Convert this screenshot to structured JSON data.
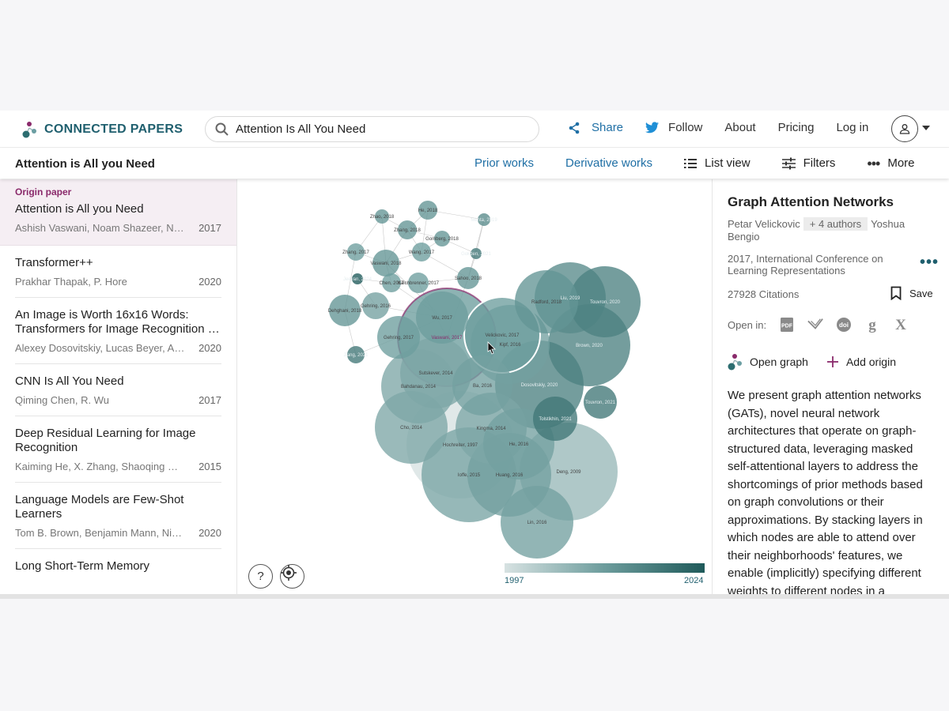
{
  "app": {
    "logo_text": "CONNECTED PAPERS",
    "search_value": "Attention Is All You Need"
  },
  "nav": {
    "share": "Share",
    "follow": "Follow",
    "about": "About",
    "pricing": "Pricing",
    "login": "Log in"
  },
  "subbar": {
    "title": "Attention is All you Need",
    "prior": "Prior works",
    "derivative": "Derivative works",
    "list_view": "List view",
    "filters": "Filters",
    "more": "More"
  },
  "sidebar": {
    "origin_label": "Origin paper",
    "origin": {
      "title": "Attention is All you Need",
      "authors": "Ashish Vaswani, Noam Shazeer, Niki Parmar",
      "year": "2017"
    },
    "items": [
      {
        "title": "Transformer++",
        "authors": "Prakhar Thapak, P. Hore",
        "year": "2020"
      },
      {
        "title": "An Image is Worth 16x16 Words: Transformers for Image Recognition …",
        "authors": "Alexey Dosovitskiy, Lucas Beyer, Alexander Kolesnikov",
        "year": "2020"
      },
      {
        "title": "CNN Is All You Need",
        "authors": "Qiming Chen, R. Wu",
        "year": "2017"
      },
      {
        "title": "Deep Residual Learning for Image Recognition",
        "authors": "Kaiming He, X. Zhang, Shaoqing Ren, Jian Sun",
        "year": "2015"
      },
      {
        "title": "Language Models are Few-Shot Learners",
        "authors": "Tom B. Brown, Benjamin Mann, Nick Ryder",
        "year": "2020"
      },
      {
        "title": "Long Short-Term Memory",
        "authors": "",
        "year": ""
      }
    ]
  },
  "graph": {
    "legend_min": "1997",
    "legend_max": "2024",
    "help_label": "?",
    "nodes": [
      {
        "label": "Zhao, 2018",
        "year": 2018
      },
      {
        "label": "He, 2018",
        "year": 2018
      },
      {
        "label": "Mehta, 2019",
        "year": 2019
      },
      {
        "label": "Zhang, 2018",
        "year": 2018
      },
      {
        "label": "Gomberg, 2018",
        "year": 2018
      },
      {
        "label": "Wang, 2017",
        "year": 2017
      },
      {
        "label": "Gokden, 2021",
        "year": 2021
      },
      {
        "label": "Zhang, 2017",
        "year": 2017
      },
      {
        "label": "Vaswani, 2018",
        "year": 2018
      },
      {
        "label": "Jeevan, 2024",
        "year": 2024
      },
      {
        "label": "Chen, 2017",
        "year": 2017
      },
      {
        "label": "Kalchbrenner, 2017",
        "year": 2017
      },
      {
        "label": "Sahoo, 2018",
        "year": 2018
      },
      {
        "label": "Dehghani, 2018",
        "year": 2018
      },
      {
        "label": "Gehring, 2016",
        "year": 2016
      },
      {
        "label": "Wu, 2017",
        "year": 2017
      },
      {
        "label": "Gehring, 2017",
        "year": 2017
      },
      {
        "label": "Jiang, 2021",
        "year": 2021
      },
      {
        "label": "Vaswani, 2017",
        "year": 2017
      },
      {
        "label": "Velickovic, 2017",
        "year": 2017
      },
      {
        "label": "Kipf, 2016",
        "year": 2016
      },
      {
        "label": "Radford, 2018",
        "year": 2018
      },
      {
        "label": "Liu, 2019",
        "year": 2019
      },
      {
        "label": "Touvron, 2020",
        "year": 2020
      },
      {
        "label": "Brown, 2020",
        "year": 2020
      },
      {
        "label": "Sutskever, 2014",
        "year": 2014
      },
      {
        "label": "Bahdanau, 2014",
        "year": 2014
      },
      {
        "label": "Ba, 2016",
        "year": 2016
      },
      {
        "label": "Dosovitskiy, 2020",
        "year": 2020
      },
      {
        "label": "Touvron, 2021",
        "year": 2021
      },
      {
        "label": "Tolstikhin, 2021",
        "year": 2021
      },
      {
        "label": "Cho, 2014",
        "year": 2014
      },
      {
        "label": "Hochreiter, 1997",
        "year": 1997
      },
      {
        "label": "Kingma, 2014",
        "year": 2014
      },
      {
        "label": "He, 2016",
        "year": 2016
      },
      {
        "label": "Ioffe, 2015",
        "year": 2015
      },
      {
        "label": "Huang, 2016",
        "year": 2016
      },
      {
        "label": "Deng, 2009",
        "year": 2009
      },
      {
        "label": "Lin, 2016",
        "year": 2016
      }
    ]
  },
  "panel": {
    "title": "Graph Attention Networks",
    "author_first": "Petar Velickovic",
    "authors_more": "+ 4 authors",
    "author_last": "Yoshua Bengio",
    "venue": "2017, International Conference on Learning Representations",
    "citations": "27928 Citations",
    "save": "Save",
    "open_in": "Open in:",
    "open_graph": "Open graph",
    "add_origin": "Add origin",
    "abstract": "We present graph attention networks (GATs), novel neural network architectures that operate on graph-structured data, leveraging masked self-attentional layers to address the shortcomings of prior methods based on graph convolutions or their approximations. By stacking layers in which nodes are able to attend over their neighborhoods' features, we enable (implicitly) specifying different weights to different nodes in a neighborhood"
  },
  "icons": [
    "logo-icon",
    "search-icon",
    "share-icon",
    "twitter-icon",
    "user-icon",
    "list-icon",
    "filter-icon",
    "more-dots-icon",
    "help-icon",
    "locate-icon",
    "bookmark-icon",
    "pdf-icon",
    "semantic-scholar-icon",
    "doi-icon",
    "google-scholar-icon",
    "x-icon",
    "graph-icon",
    "plus-icon"
  ],
  "colors": {
    "brand": "#1f5f6e",
    "link": "#1f6fa5",
    "origin": "#8a2a6b",
    "origin_bg": "#f5eef3"
  }
}
